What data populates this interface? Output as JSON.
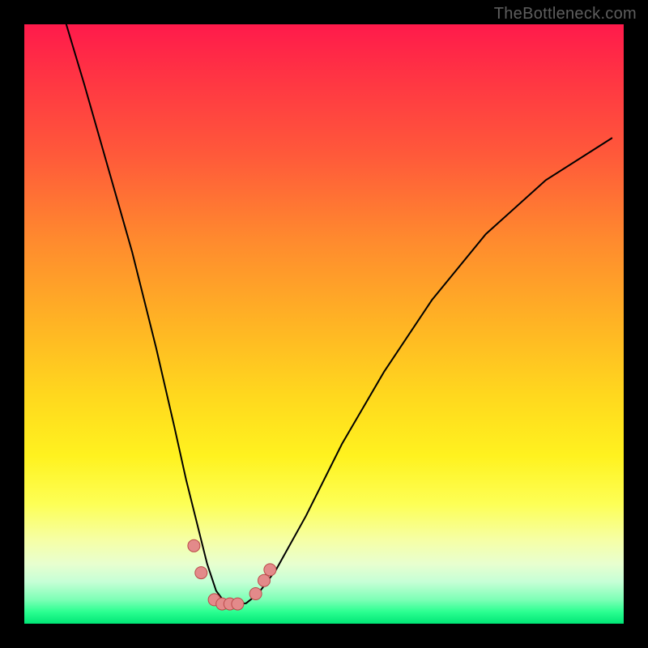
{
  "watermark": "TheBottleneck.com",
  "chart_data": {
    "type": "line",
    "title": "",
    "xlabel": "",
    "ylabel": "",
    "xlim": [
      0,
      100
    ],
    "ylim": [
      0,
      100
    ],
    "grid": false,
    "legend": false,
    "annotations": [],
    "series": [
      {
        "name": "curve",
        "x": [
          7,
          10,
          14,
          18,
          22,
          25,
          27,
          29,
          30.5,
          32,
          33.5,
          35,
          37,
          39,
          42,
          47,
          53,
          60,
          68,
          77,
          87,
          98
        ],
        "y": [
          100,
          90,
          76,
          62,
          46,
          33,
          24,
          16,
          10,
          5.5,
          3.5,
          3.2,
          3.4,
          5,
          9,
          18,
          30,
          42,
          54,
          65,
          74,
          81
        ]
      }
    ],
    "markers": [
      {
        "x": 28.3,
        "y": 13.0
      },
      {
        "x": 29.5,
        "y": 8.5
      },
      {
        "x": 31.7,
        "y": 4.0
      },
      {
        "x": 33.0,
        "y": 3.3
      },
      {
        "x": 34.3,
        "y": 3.3
      },
      {
        "x": 35.6,
        "y": 3.3
      },
      {
        "x": 38.6,
        "y": 5.0
      },
      {
        "x": 40.0,
        "y": 7.2
      },
      {
        "x": 41.0,
        "y": 9.0
      }
    ],
    "colors": {
      "gradient_top": "#ff1a4b",
      "gradient_mid": "#ffd81e",
      "gradient_bottom": "#00e676",
      "curve": "#000000",
      "marker_fill": "#e38a8a",
      "marker_stroke": "#bb4a4a",
      "frame": "#000000"
    }
  }
}
